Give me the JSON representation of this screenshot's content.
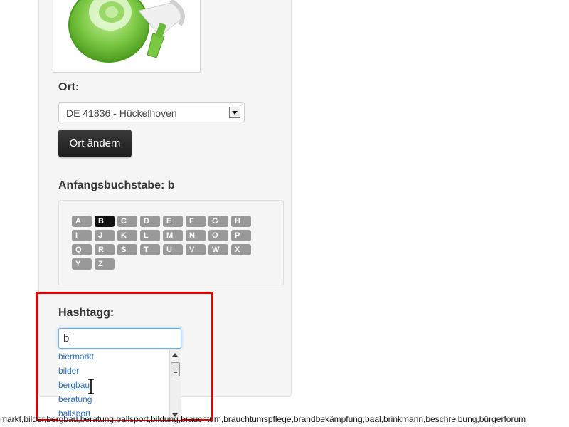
{
  "location": {
    "label": "Ort:",
    "selected": "DE 41836 - Hückelhoven",
    "change_button": "Ort ändern"
  },
  "alphabet": {
    "label": "Anfangsbuchstabe: b",
    "letters": [
      "A",
      "B",
      "C",
      "D",
      "E",
      "F",
      "G",
      "H",
      "I",
      "J",
      "K",
      "L",
      "M",
      "N",
      "O",
      "P",
      "Q",
      "R",
      "S",
      "T",
      "U",
      "V",
      "W",
      "X",
      "Y",
      "Z"
    ],
    "active": "B"
  },
  "hashtag": {
    "label": "Hashtagg:",
    "input_value": "b",
    "suggestions": [
      "biermarkt",
      "bilder",
      "bergbau",
      "beratung",
      "ballsport"
    ],
    "hovered": "bergbau"
  },
  "tag_strip": "markt,bilder,bergbau,beratung,ballsport,bildung,brauchtum,brauchtumspflege,brandbekämpfung,baal,brinkmann,beschreibung,bürgerforum",
  "colors": {
    "highlight_border": "#e00000",
    "link": "#2a6fc4",
    "letter_bg": "#999999",
    "letter_active_bg": "#111111",
    "megaphone_green": "#7bc843"
  },
  "icons": {
    "image": "megaphone-image",
    "select_arrow": "chevron-down-icon",
    "text_cursor": "i-beam-cursor-icon"
  }
}
